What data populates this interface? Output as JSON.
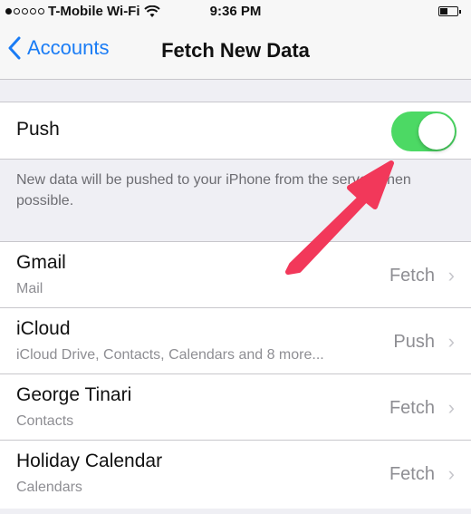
{
  "status_bar": {
    "carrier": "T-Mobile Wi-Fi",
    "time": "9:36 PM"
  },
  "nav": {
    "back_label": "Accounts",
    "title": "Fetch New Data"
  },
  "push": {
    "label": "Push",
    "enabled": true,
    "footer": "New data will be pushed to your iPhone from the server when possible."
  },
  "accounts": [
    {
      "name": "Gmail",
      "subtitle": "Mail",
      "value": "Fetch"
    },
    {
      "name": "iCloud",
      "subtitle": "iCloud Drive, Contacts, Calendars and 8 more...",
      "value": "Push"
    },
    {
      "name": "George Tinari",
      "subtitle": "Contacts",
      "value": "Fetch"
    },
    {
      "name": "Holiday Calendar",
      "subtitle": "Calendars",
      "value": "Fetch"
    }
  ],
  "colors": {
    "accent": "#1a7cf5",
    "toggle_on": "#4cd964",
    "annotation_arrow": "#f2385a"
  },
  "icons": {
    "back": "chevron-left-icon",
    "wifi": "wifi-icon",
    "battery": "battery-icon",
    "row": "chevron-right-icon"
  }
}
